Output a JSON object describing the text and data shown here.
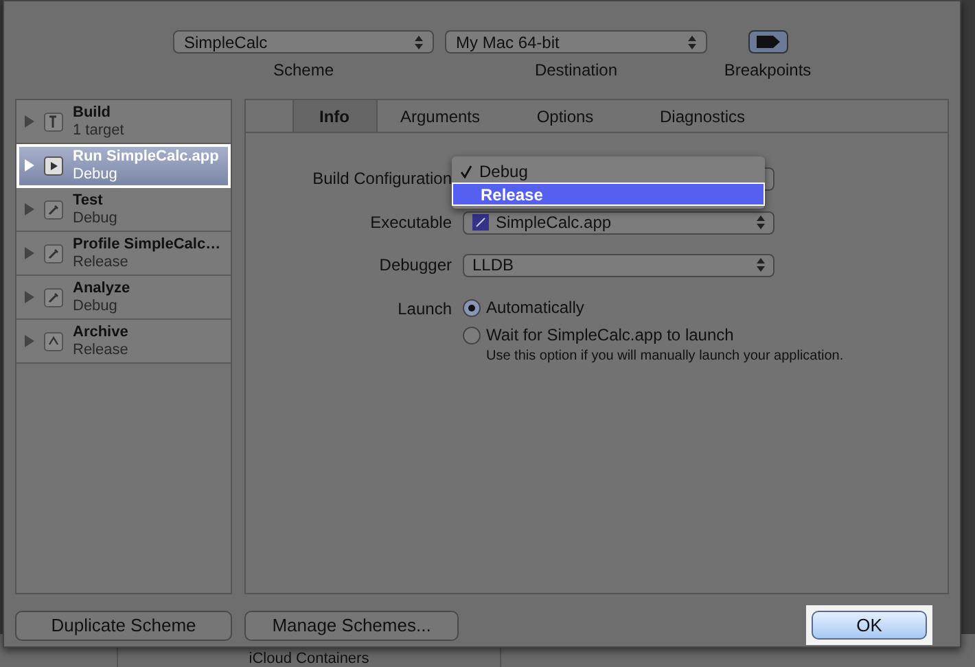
{
  "toolbar": {
    "scheme": {
      "value": "SimpleCalc",
      "label": "Scheme"
    },
    "destination": {
      "value": "My Mac 64-bit",
      "label": "Destination"
    },
    "breakpoints": {
      "label": "Breakpoints"
    }
  },
  "actions": [
    {
      "title": "Build",
      "subtitle": "1 target",
      "selected": false
    },
    {
      "title": "Run SimpleCalc.app",
      "subtitle": "Debug",
      "selected": true
    },
    {
      "title": "Test",
      "subtitle": "Debug",
      "selected": false
    },
    {
      "title": "Profile SimpleCalc…",
      "subtitle": "Release",
      "selected": false
    },
    {
      "title": "Analyze",
      "subtitle": "Debug",
      "selected": false
    },
    {
      "title": "Archive",
      "subtitle": "Release",
      "selected": false
    }
  ],
  "tabs": [
    {
      "label": "Info",
      "selected": true
    },
    {
      "label": "Arguments",
      "selected": false
    },
    {
      "label": "Options",
      "selected": false
    },
    {
      "label": "Diagnostics",
      "selected": false
    }
  ],
  "build_configuration": {
    "label": "Build Configuration",
    "menu": [
      {
        "label": "Debug",
        "checked": true,
        "highlighted": false
      },
      {
        "label": "Release",
        "checked": false,
        "highlighted": true
      }
    ]
  },
  "executable": {
    "label": "Executable",
    "value": "SimpleCalc.app"
  },
  "debugger": {
    "label": "Debugger",
    "value": "LLDB"
  },
  "launch": {
    "label": "Launch",
    "options": [
      {
        "label": "Automatically",
        "selected": true
      },
      {
        "label": "Wait for SimpleCalc.app to launch",
        "selected": false,
        "note": "Use this option if you will manually launch your application."
      }
    ]
  },
  "buttons": {
    "duplicate": "Duplicate Scheme",
    "manage": "Manage Schemes...",
    "ok": "OK"
  },
  "background_text": "iCloud Containers"
}
